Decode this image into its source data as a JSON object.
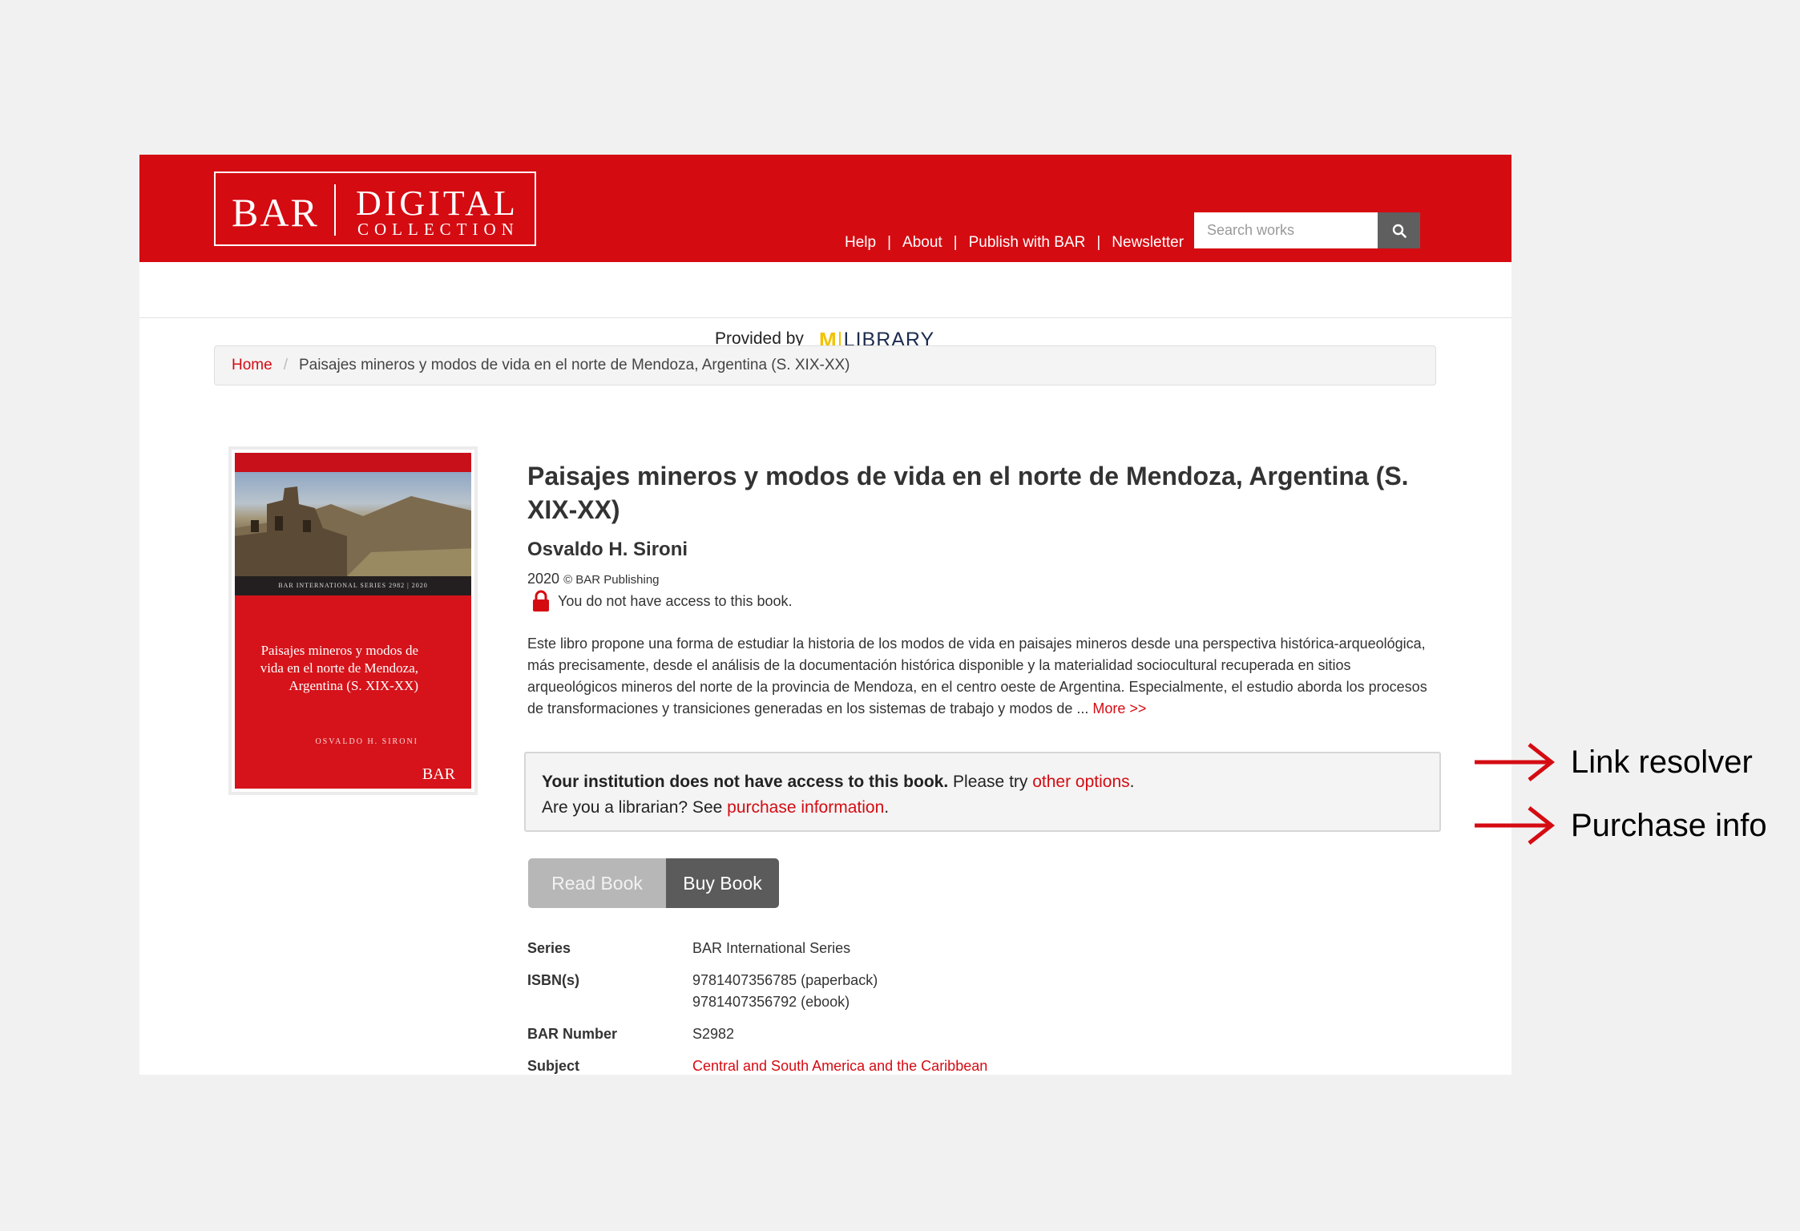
{
  "colors": {
    "brand": "#d50b12",
    "accent_link": "#d50b12",
    "michigan_maize": "#f2c200",
    "michigan_blue": "#1d2c4f"
  },
  "header": {
    "logo": {
      "bar": "BAR",
      "digital": "DIGITAL",
      "collection": "COLLECTION"
    },
    "nav": [
      "Help",
      "About",
      "Publish with BAR",
      "Newsletter"
    ],
    "nav_separator": "|",
    "search": {
      "placeholder": "Search works",
      "icon": "search-icon"
    }
  },
  "provided": {
    "text": "Provided by",
    "logo_m": "M",
    "logo_library": "LIBRARY"
  },
  "breadcrumb": {
    "home": "Home",
    "separator": "/",
    "current": "Paisajes mineros y modos de vida en el norte de Mendoza, Argentina (S. XIX-XX)"
  },
  "cover": {
    "series": "BAR INTERNATIONAL SERIES 2982  |  2020",
    "title": "Paisajes mineros y modos de vida en el norte de Mendoza, Argentina (S. XIX-XX)",
    "author": "OSVALDO H. SIRONI",
    "publisher_logo": "BAR"
  },
  "book": {
    "title": "Paisajes mineros y modos de vida en el norte de Mendoza, Argentina (S. XIX-XX)",
    "author": "Osvaldo H. Sironi",
    "year": "2020",
    "copyright": "© BAR Publishing",
    "access_icon": "lock-icon",
    "access_message": "You do not have access to this book.",
    "abstract": "Este libro propone una forma de estudiar la historia de los modos de vida en paisajes mineros desde una perspectiva histórica-arqueológica, más precisamente, desde el análisis de la documentación histórica disponible y la materialidad sociocultural recuperada en sitios arqueológicos mineros del norte de la provincia de Mendoza, en el centro oeste de Argentina. Especialmente, el estudio aborda los procesos de transformaciones y transiciones generadas en los sistemas de trabajo y modos de ... ",
    "more_link": "More >>"
  },
  "alert": {
    "bold": "Your institution does not have access to this book.",
    "text1": " Please try ",
    "link1": "other options",
    "text1_end": ".",
    "text2": "Are you a librarian? See ",
    "link2": "purchase information",
    "text2_end": "."
  },
  "buttons": {
    "read": "Read Book",
    "buy": "Buy Book"
  },
  "meta": {
    "series_label": "Series",
    "series_value": "BAR International Series",
    "isbn_label": "ISBN(s)",
    "isbn_values": [
      "9781407356785 (paperback)",
      "9781407356792 (ebook)"
    ],
    "bar_number_label": "BAR Number",
    "bar_number_value": "S2982",
    "subject_label": "Subject",
    "subject_value": "Central and South America and the Caribbean"
  },
  "annotations": [
    {
      "label": "Link resolver",
      "icon": "arrow-right-icon"
    },
    {
      "label": "Purchase info",
      "icon": "arrow-right-icon"
    }
  ]
}
